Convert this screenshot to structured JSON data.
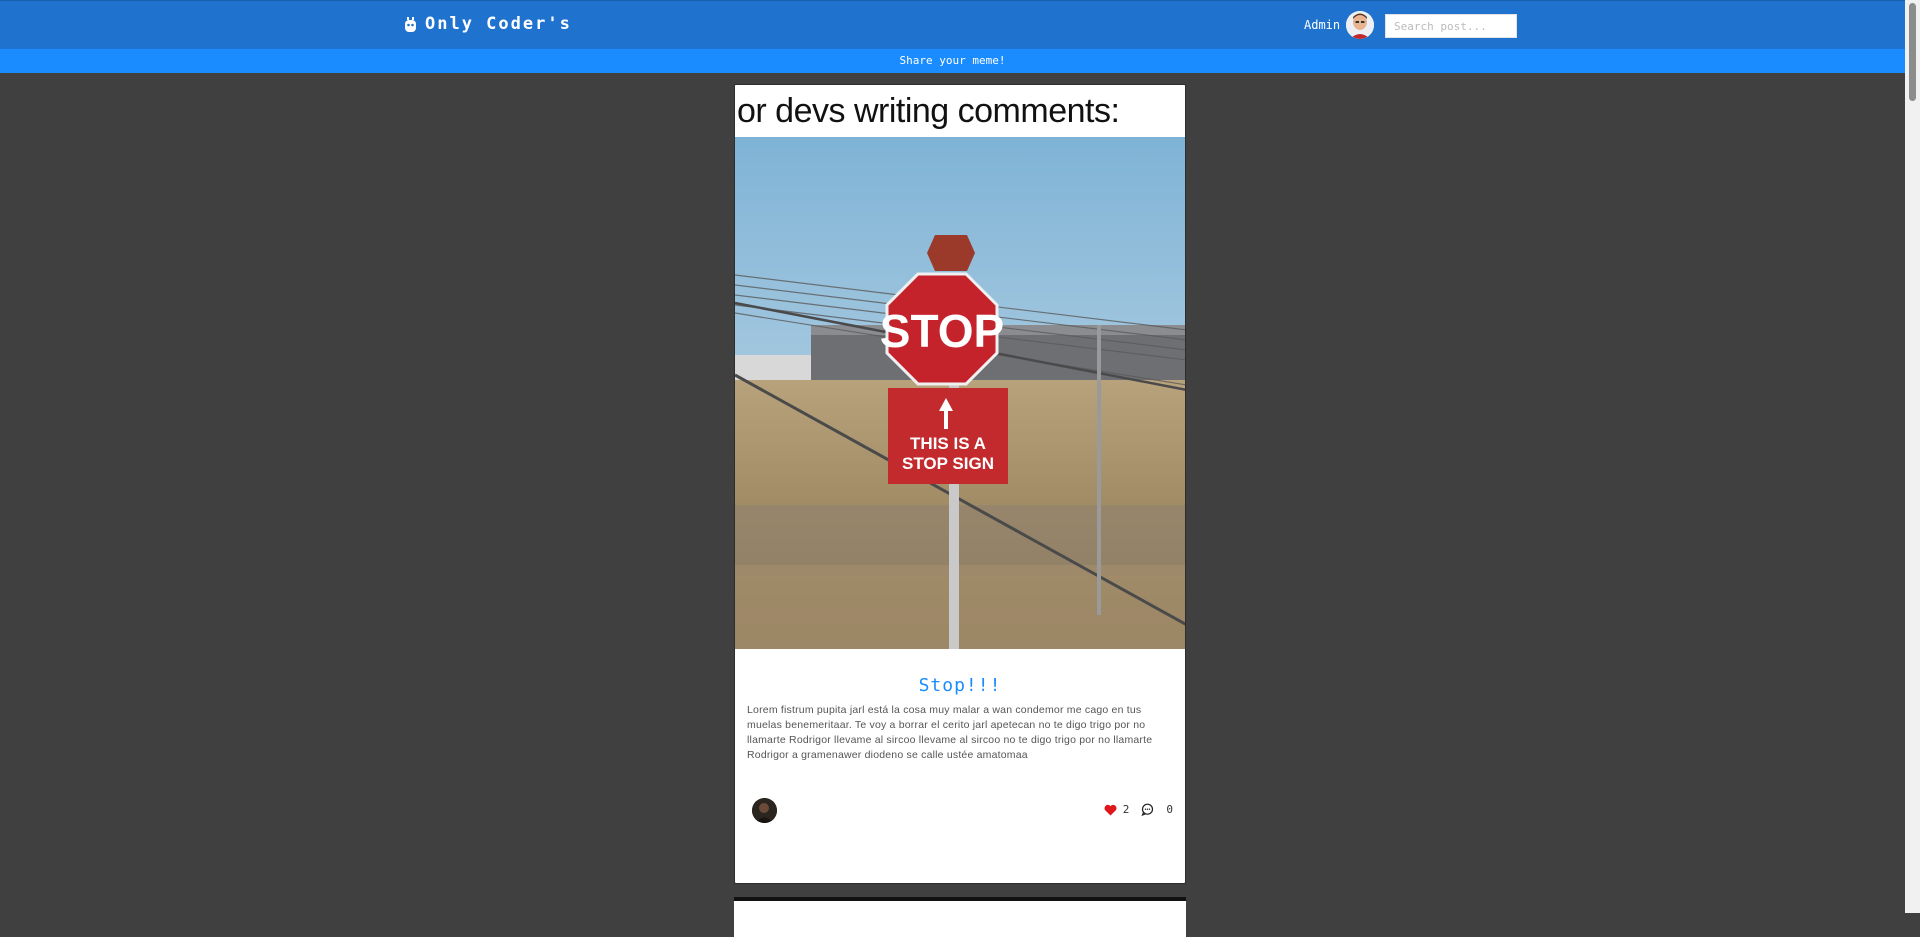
{
  "header": {
    "brand": "Only Coder's",
    "brand_icon": "robot-icon",
    "user_name": "Admin",
    "search_placeholder": "Search post...",
    "share_link": "Share your meme!"
  },
  "posts": [
    {
      "image_caption": "or devs writing comments:",
      "sign_top": "STOP",
      "sign_bottom_line1": "THIS IS A",
      "sign_bottom_line2": "STOP SIGN",
      "title": "Stop!!!",
      "body": "Lorem fistrum pupita jarl está la cosa muy malar a wan condemor me cago en tus muelas benemeritaar. Te voy a borrar el cerito jarl apetecan no te digo trigo por no llamarte Rodrigor llevame al sircoo llevame al sircoo no te digo trigo por no llamarte Rodrigor a gramenawer diodeno se calle ustée amatomaa",
      "likes": "2",
      "comments": "0"
    }
  ],
  "colors": {
    "header_bg": "#1f73cf",
    "subbar_bg": "#1a8cff",
    "page_bg": "#404040",
    "accent": "#1a8cff",
    "like": "#e0161d"
  }
}
